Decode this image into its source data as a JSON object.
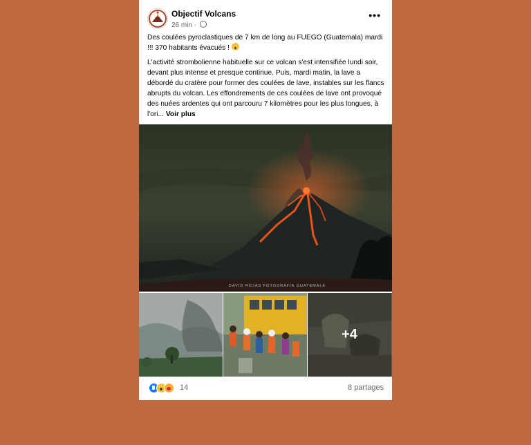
{
  "post": {
    "page_name": "Objectif Volcans",
    "time": "26 min",
    "privacy_icon": "globe-icon",
    "more_icon": "more-options-icon",
    "headline": "Des coulées pyroclastiques de 7 km de long au FUEGO (Guatemala) mardi !!! 370 habitants évacués !",
    "body": "L'activité strombolienne habituelle sur ce volcan s'est intensifiée lundi soir, devant plus intense et presque continue. Puis, mardi matin, la lave a débordé du cratère pour former des coulées de lave, instables sur les flancs abrupts du volcan. Les effondrements de ces coulées de lave ont provoqué des nuées ardentes qui ont parcouru 7 kilomètres pour les plus longues, à l'ori...",
    "see_more": "Voir plus"
  },
  "media": {
    "main_caption": "DAVID ROJAS FOTOGRAFÍA GUATEMALA",
    "more_count": "+4"
  },
  "footer": {
    "reaction_count": "14",
    "shares": "8 partages",
    "reaction_icons": [
      "like-icon",
      "wow-icon",
      "care-icon"
    ]
  }
}
